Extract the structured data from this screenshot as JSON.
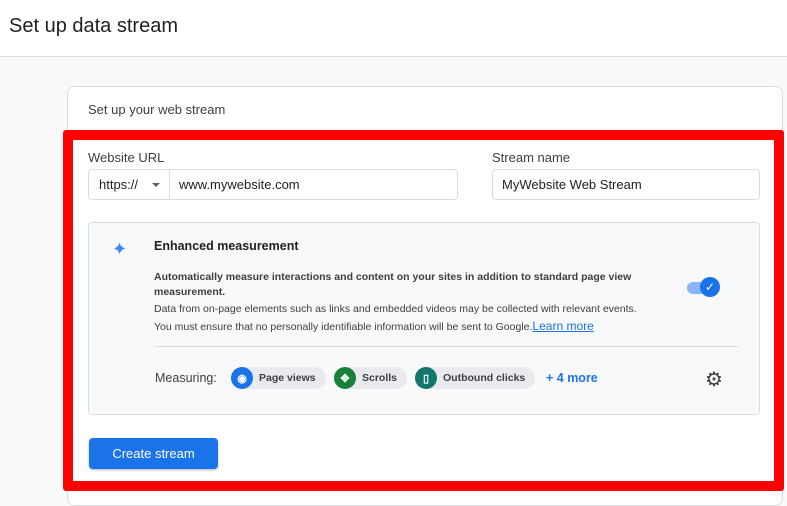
{
  "header": {
    "title": "Set up data stream"
  },
  "card": {
    "title": "Set up your web stream"
  },
  "website_url": {
    "label": "Website URL",
    "protocol": "https://",
    "value": "www.mywebsite.com"
  },
  "stream_name": {
    "label": "Stream name",
    "value": "MyWebsite Web Stream"
  },
  "enhanced": {
    "title": "Enhanced measurement",
    "description": "Automatically measure interactions and content on your sites in addition to standard page view measurement.",
    "line1": "Data from on-page elements such as links and embedded videos may be collected with relevant events.",
    "line2": "You must ensure that no personally identifiable information will be sent to Google.",
    "learn_more": "Learn more",
    "toggle_on": true,
    "measuring_label": "Measuring:",
    "chips": [
      {
        "label": "Page views",
        "icon": "eye-icon",
        "color": "#1a73e8"
      },
      {
        "label": "Scrolls",
        "icon": "scroll-icon",
        "color": "#188038"
      },
      {
        "label": "Outbound clicks",
        "icon": "mouse-icon",
        "color": "#12766d"
      }
    ],
    "more": "+ 4 more"
  },
  "create_button": "Create stream"
}
